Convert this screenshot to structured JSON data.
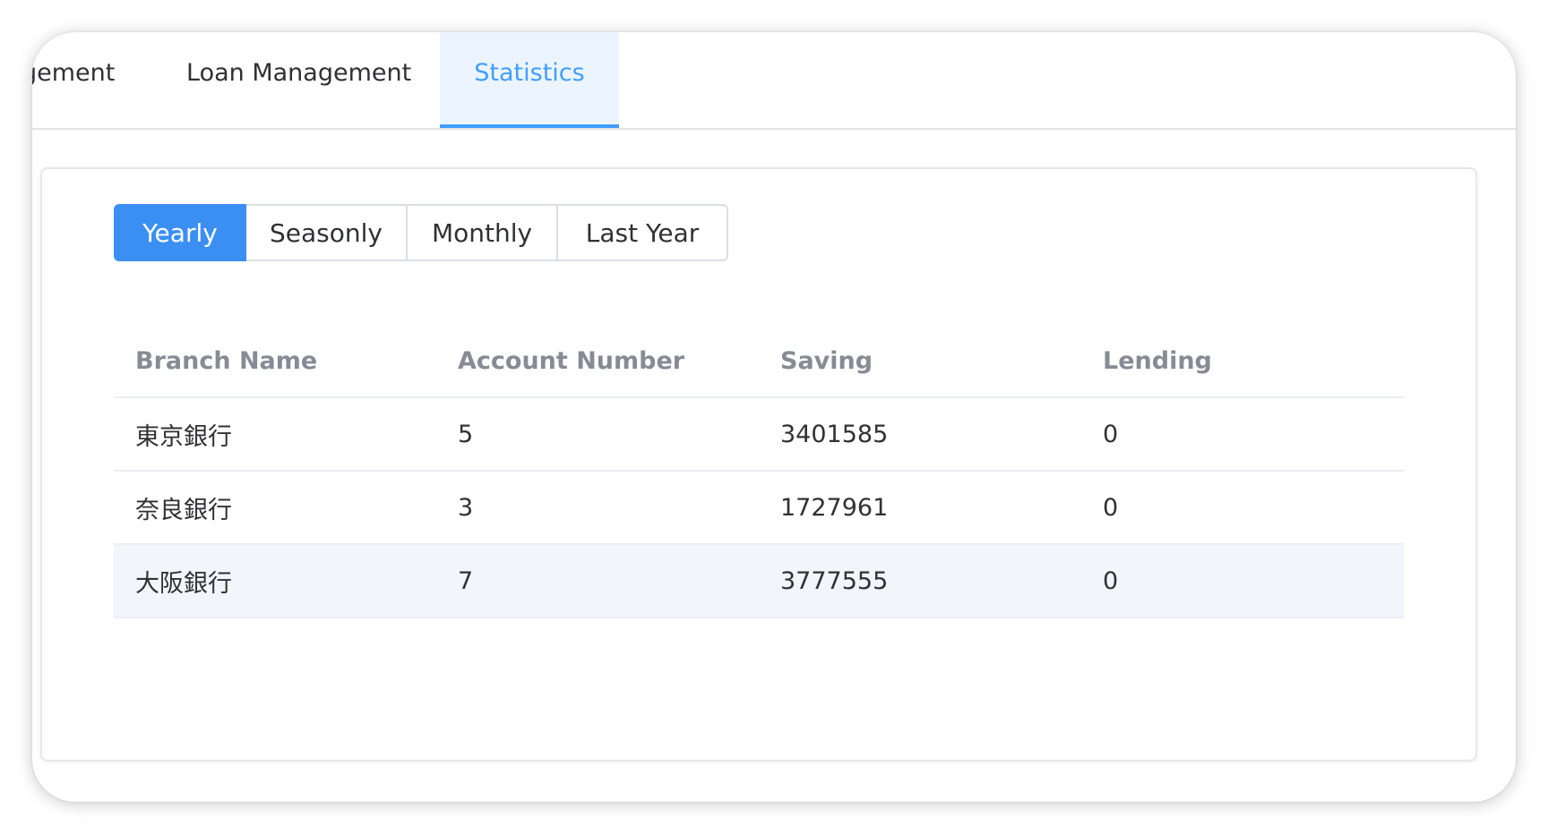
{
  "tabs": [
    {
      "label": "gement",
      "active": false
    },
    {
      "label": "Loan Management",
      "active": false
    },
    {
      "label": "Statistics",
      "active": true
    }
  ],
  "period_buttons": [
    {
      "label": "Yearly",
      "selected": true
    },
    {
      "label": "Seasonly",
      "selected": false
    },
    {
      "label": "Monthly",
      "selected": false
    },
    {
      "label": "Last Year",
      "selected": false
    }
  ],
  "table": {
    "columns": [
      "Branch Name",
      "Account Number",
      "Saving",
      "Lending"
    ],
    "rows": [
      [
        "東京銀行",
        "5",
        "3401585",
        "0"
      ],
      [
        "奈良銀行",
        "3",
        "1727961",
        "0"
      ],
      [
        "大阪銀行",
        "7",
        "3777555",
        "0"
      ]
    ],
    "highlighted_row": 2
  },
  "colors": {
    "accent": "#409eff",
    "button_active": "#3b8ff3",
    "active_tab_bg": "#ecf5ff",
    "row_highlight": "#f2f5fa"
  }
}
